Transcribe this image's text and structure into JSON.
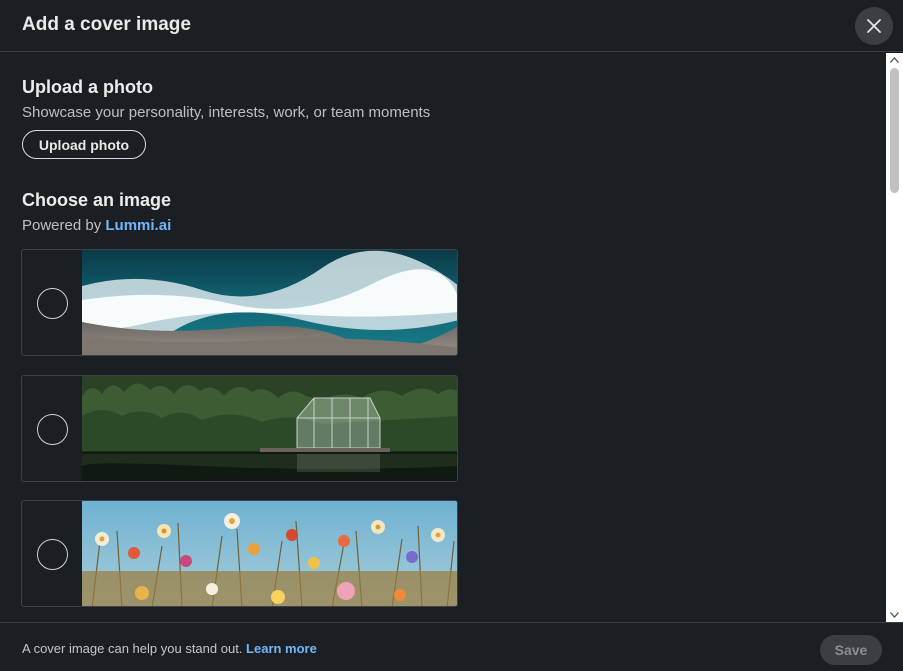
{
  "header": {
    "title": "Add a cover image",
    "close_icon": "close-icon"
  },
  "upload": {
    "title": "Upload a photo",
    "subtitle": "Showcase your personality, interests, work, or team moments",
    "button_label": "Upload photo"
  },
  "choose": {
    "title": "Choose an image",
    "powered_prefix": "Powered by",
    "powered_link": "Lummi.ai"
  },
  "images": [
    {
      "name": "ocean-waves-image"
    },
    {
      "name": "greenhouse-lake-image"
    },
    {
      "name": "wildflowers-image"
    }
  ],
  "footer": {
    "text": "A cover image can help you stand out.",
    "link": "Learn more",
    "save_label": "Save"
  },
  "colors": {
    "background": "#1b1f23",
    "link": "#71b7fb",
    "divider": "#3a3f44"
  }
}
